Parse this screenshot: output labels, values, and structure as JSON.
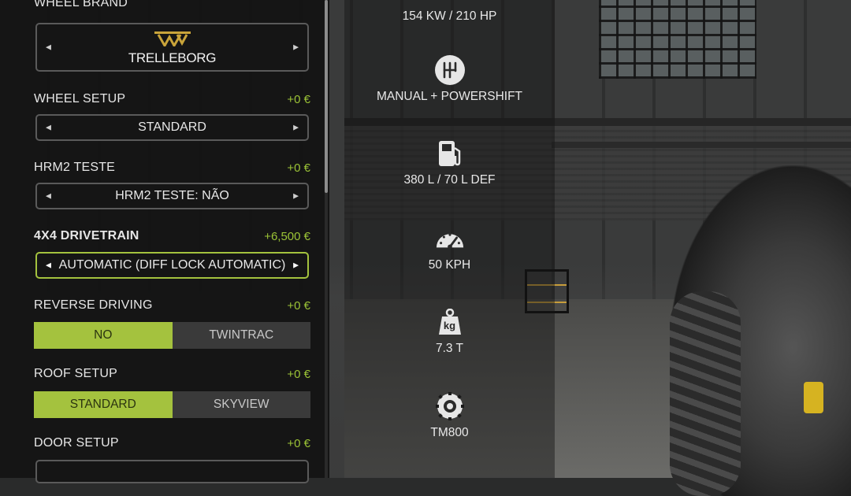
{
  "options": {
    "wheel_brand": {
      "label": "WHEEL BRAND",
      "brand_name": "TRELLEBORG",
      "logo_letters": "TW"
    },
    "wheel_setup": {
      "label": "WHEEL SETUP",
      "price": "+0 €",
      "value": "STANDARD"
    },
    "hrm2": {
      "label": "HRM2 TESTE",
      "price": "+0 €",
      "value": "HRM2 TESTE: NÃO"
    },
    "drivetrain": {
      "label": "4X4 DRIVETRAIN",
      "price": "+6,500 €",
      "value": "AUTOMATIC (DIFF LOCK AUTOMATIC)"
    },
    "reverse_driving": {
      "label": "REVERSE DRIVING",
      "price": "+0 €",
      "options": [
        "NO",
        "TWINTRAC"
      ],
      "selected": "NO"
    },
    "roof_setup": {
      "label": "ROOF SETUP",
      "price": "+0 €",
      "options": [
        "STANDARD",
        "SKYVIEW"
      ],
      "selected": "STANDARD"
    },
    "door_setup": {
      "label": "DOOR SETUP",
      "price": "+0 €"
    }
  },
  "stats": {
    "power": "154 KW / 210 HP",
    "transmission": "MANUAL + POWERSHIFT",
    "fuel": "380 L / 70 L DEF",
    "speed": "50 KPH",
    "weight": "7.3 T",
    "weight_icon_text": "kg",
    "tires": "TM800"
  },
  "colors": {
    "accent": "#a4c23e",
    "price_green": "#9cc436",
    "panel_bg": "#121212"
  },
  "icons": [
    "chevron-left-icon",
    "chevron-right-icon",
    "gearbox-icon",
    "fuel-pump-icon",
    "speedometer-icon",
    "weight-icon",
    "tire-icon"
  ]
}
